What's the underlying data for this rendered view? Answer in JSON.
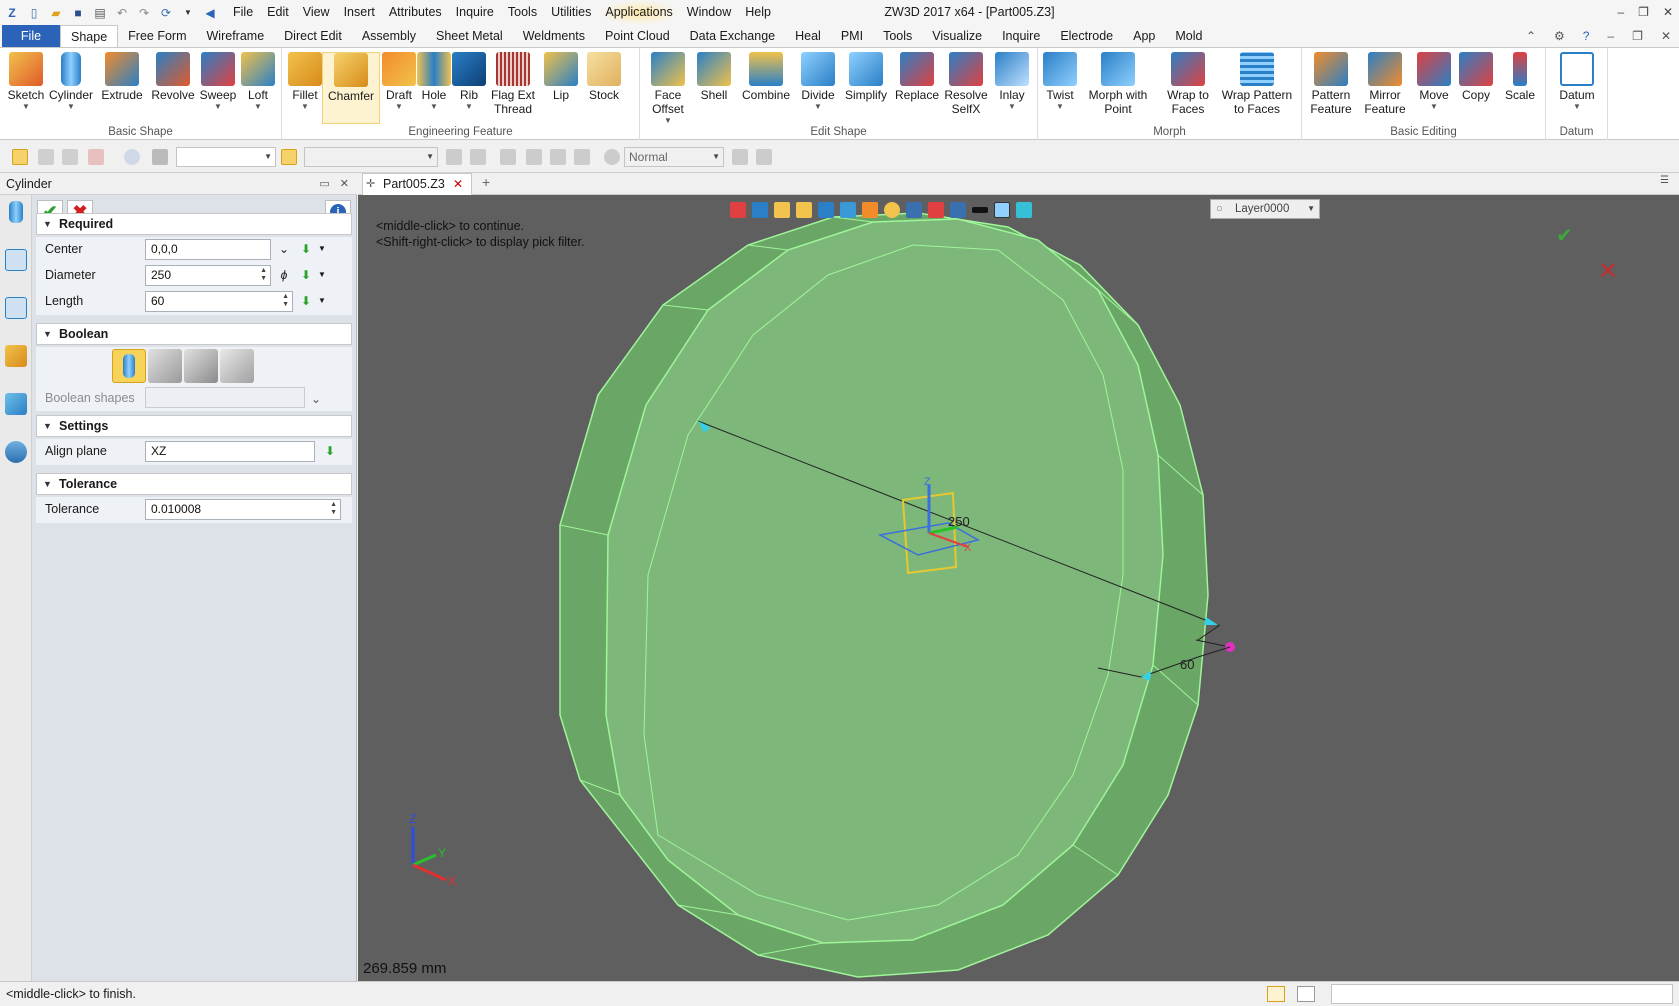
{
  "app": {
    "window_title": "ZW3D 2017  x64 - [Part005.Z3]",
    "menu": [
      "File",
      "Edit",
      "View",
      "Insert",
      "Attributes",
      "Inquire",
      "Tools",
      "Utilities",
      "Applications",
      "Window",
      "Help"
    ]
  },
  "ribbon": {
    "file_label": "File",
    "tabs": [
      "Shape",
      "Free Form",
      "Wireframe",
      "Direct Edit",
      "Assembly",
      "Sheet Metal",
      "Weldments",
      "Point Cloud",
      "Data Exchange",
      "Heal",
      "PMI",
      "Tools",
      "Visualize",
      "Inquire",
      "Electrode",
      "App",
      "Mold"
    ],
    "active_tab": "Shape",
    "groups": [
      {
        "name": "Basic Shape",
        "buttons": [
          "Sketch",
          "Cylinder",
          "Extrude",
          "Revolve",
          "Sweep",
          "Loft"
        ]
      },
      {
        "name": "Engineering Feature",
        "buttons": [
          "Fillet",
          "Chamfer",
          "Draft",
          "Hole",
          "Rib",
          "Flag Ext Thread",
          "Lip",
          "Stock"
        ]
      },
      {
        "name": "Edit Shape",
        "buttons": [
          "Face Offset",
          "Shell",
          "Combine",
          "Divide",
          "Simplify",
          "Replace",
          "Resolve SelfX",
          "Inlay"
        ]
      },
      {
        "name": "Morph",
        "buttons": [
          "Twist",
          "Morph with Point",
          "Wrap to Faces",
          "Wrap Pattern to Faces"
        ]
      },
      {
        "name": "Basic Editing",
        "buttons": [
          "Pattern Feature",
          "Mirror Feature",
          "Move",
          "Copy",
          "Scale"
        ]
      },
      {
        "name": "Datum",
        "buttons": [
          "Datum"
        ]
      }
    ]
  },
  "toolbar": {
    "render_mode": "Normal"
  },
  "panel": {
    "title": "Cylinder",
    "required": {
      "label": "Required",
      "center_label": "Center",
      "center_value": "0,0,0",
      "diameter_label": "Diameter",
      "diameter_value": "250",
      "length_label": "Length",
      "length_value": "60"
    },
    "boolean": {
      "label": "Boolean",
      "shapes_label": "Boolean shapes"
    },
    "settings": {
      "label": "Settings",
      "align_label": "Align plane",
      "align_value": "XZ"
    },
    "tolerance": {
      "label": "Tolerance",
      "tol_label": "Tolerance",
      "tol_value": "0.010008"
    }
  },
  "document": {
    "tab": "Part005.Z3"
  },
  "viewport": {
    "hint1": "<middle-click> to continue.",
    "hint2": "<Shift-right-click> to display pick filter.",
    "layer": "Layer0000",
    "dim_diameter": "250",
    "dim_length": "60",
    "measure": "269.859 mm",
    "colors": {
      "body": "#7db87a",
      "edge": "#9ff59a",
      "background": "#5f5f5f"
    }
  },
  "status": {
    "text": "<middle-click> to finish."
  }
}
